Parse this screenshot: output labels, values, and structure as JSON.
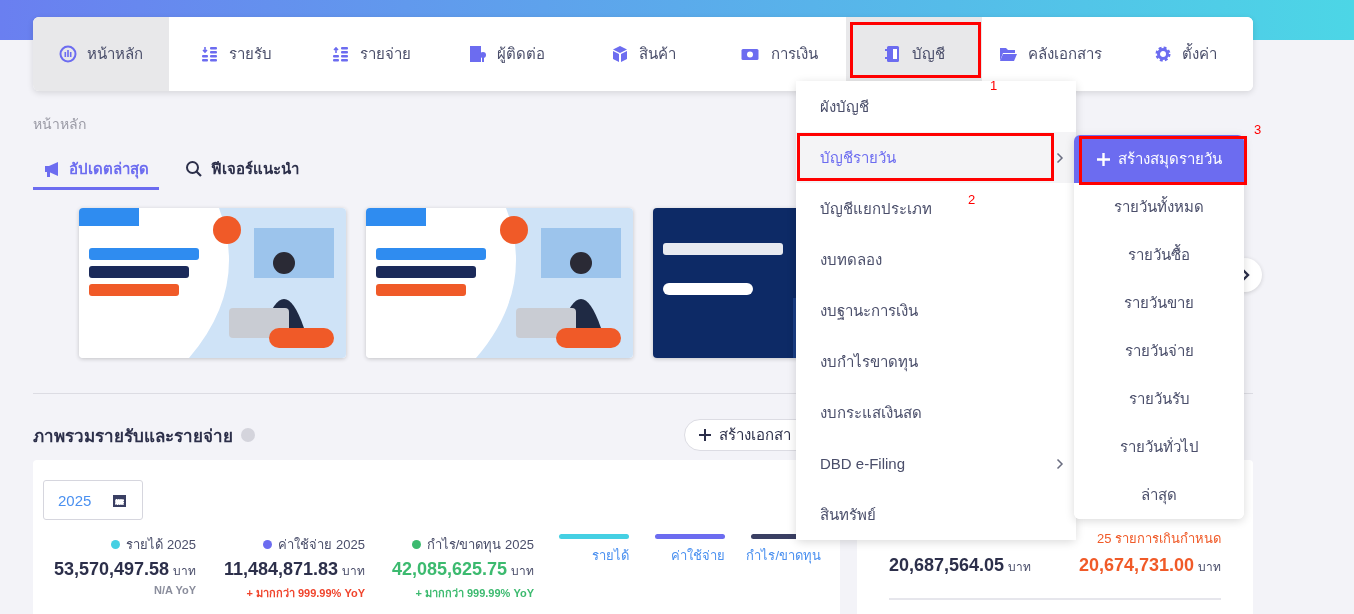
{
  "nav": {
    "items": [
      {
        "label": "หน้าหลัก",
        "selected": true
      },
      {
        "label": "รายรับ",
        "selected": false
      },
      {
        "label": "รายจ่าย",
        "selected": false
      },
      {
        "label": "ผู้ติดต่อ",
        "selected": false
      },
      {
        "label": "สินค้า",
        "selected": false
      },
      {
        "label": "การเงิน",
        "selected": false
      },
      {
        "label": "บัญชี",
        "selected": true
      },
      {
        "label": "คลังเอกสาร",
        "selected": false
      },
      {
        "label": "ตั้งค่า",
        "selected": false
      }
    ]
  },
  "breadcrumb": "หน้าหลัก",
  "tabs": [
    {
      "label": "อัปเดตล่าสุด",
      "selected": true
    },
    {
      "label": "ฟีเจอร์แนะนำ",
      "selected": false
    }
  ],
  "overview": {
    "title": "ภาพรวมรายรับและรายจ่าย",
    "create_button": "สร้างเอกสา",
    "year": "2025",
    "stats": [
      {
        "label": "รายได้ 2025",
        "color": "#45d0e3",
        "amount": "53,570,497.58",
        "unit": "บาท",
        "change": "N/A YoY",
        "kind": "neutral"
      },
      {
        "label": "ค่าใช้จ่าย 2025",
        "color": "#6c6cf0",
        "amount": "11,484,871.83",
        "unit": "บาท",
        "change": "+ มากกว่า 999.99% YoY",
        "kind": "negative"
      },
      {
        "label": "กำไร/ขาดทุน 2025",
        "color": "#3cba6f",
        "amount": "42,085,625.75",
        "unit": "บาท",
        "change": "+ มากกว่า 999.99% YoY",
        "kind": "positive"
      }
    ],
    "legend": [
      {
        "label": "รายได้",
        "color": "#45d0e3"
      },
      {
        "label": "ค่าใช้จ่าย",
        "color": "#6c6cf0"
      },
      {
        "label": "กำไร/ขาดทุน",
        "color": "#3a3f63"
      }
    ]
  },
  "receivables": {
    "note": "25 รายการเกินกำหนด",
    "amounts": [
      {
        "value": "20,687,564.05",
        "unit": "บาท",
        "kind": "neutral"
      },
      {
        "value": "20,674,731.00",
        "unit": "บาท",
        "kind": "overdue"
      }
    ]
  },
  "menu": {
    "items": [
      {
        "label": "ผังบัญชี",
        "has_submenu": false,
        "selected": false
      },
      {
        "label": "บัญชีรายวัน",
        "has_submenu": true,
        "selected": true
      },
      {
        "label": "บัญชีแยกประเภท",
        "has_submenu": false,
        "selected": false
      },
      {
        "label": "งบทดลอง",
        "has_submenu": false,
        "selected": false
      },
      {
        "label": "งบฐานะการเงิน",
        "has_submenu": false,
        "selected": false
      },
      {
        "label": "งบกำไรขาดทุน",
        "has_submenu": false,
        "selected": false
      },
      {
        "label": "งบกระแสเงินสด",
        "has_submenu": false,
        "selected": false
      },
      {
        "label": "DBD e-Filing",
        "has_submenu": true,
        "selected": false
      },
      {
        "label": "สินทรัพย์",
        "has_submenu": false,
        "selected": false
      }
    ]
  },
  "submenu": {
    "create_button": "สร้างสมุดรายวัน",
    "items": [
      "รายวันทั้งหมด",
      "รายวันซื้อ",
      "รายวันขาย",
      "รายวันจ่าย",
      "รายวันรับ",
      "รายวันทั่วไป",
      "ล่าสุด"
    ]
  },
  "annotations": [
    {
      "label": "1"
    },
    {
      "label": "2"
    },
    {
      "label": "3"
    }
  ]
}
